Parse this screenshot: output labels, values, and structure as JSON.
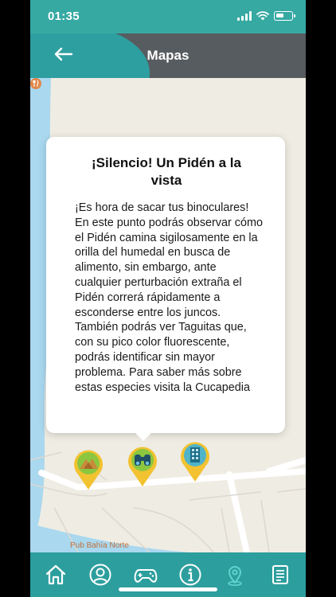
{
  "status_bar": {
    "time": "01:35"
  },
  "header": {
    "title": "Mapas",
    "back_icon": "arrow-left-icon"
  },
  "popup": {
    "title": "¡Silencio! Un Pidén a la vista",
    "body": "¡Es hora de sacar tus binoculares! En este punto podrás observar cómo el Pidén camina sigilosamente en la orilla del humedal en busca de alimento, sin embargo, ante cualquier perturbación extraña el Pidén correrá rápidamente a esconderse entre los juncos. También podrás ver Taguitas que, con su pico color fluorescente, podrás identificar sin mayor problema. Para saber más sobre estas especies visita la Cucapedia"
  },
  "map": {
    "place_label": "Pub Bahía Norte",
    "pins": [
      {
        "name": "landscape-pin",
        "icon": "mountain-icon"
      },
      {
        "name": "binoculars-pin",
        "icon": "binoculars-icon"
      },
      {
        "name": "building-pin",
        "icon": "building-icon"
      }
    ]
  },
  "bottom_nav": {
    "items": [
      {
        "icon": "home-icon",
        "active": false
      },
      {
        "icon": "user-icon",
        "active": false
      },
      {
        "icon": "gamepad-icon",
        "active": false
      },
      {
        "icon": "info-icon",
        "active": false
      },
      {
        "icon": "map-pin-icon",
        "active": true
      },
      {
        "icon": "document-icon",
        "active": false
      }
    ]
  },
  "colors": {
    "teal": "#2d9e9e",
    "header_gray": "#575c60",
    "pin_yellow": "#f2c230",
    "pin_green": "#8cc63f",
    "map_background": "#efece3",
    "water": "#a9d8ef"
  }
}
